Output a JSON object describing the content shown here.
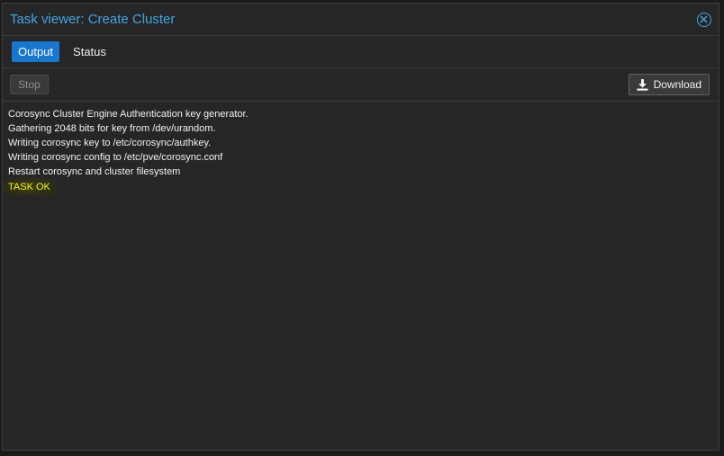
{
  "window": {
    "title": "Task viewer: Create Cluster"
  },
  "tabs": [
    {
      "label": "Output",
      "active": true
    },
    {
      "label": "Status",
      "active": false
    }
  ],
  "toolbar": {
    "stop_label": "Stop",
    "download_label": "Download"
  },
  "log": {
    "lines": [
      "Corosync Cluster Engine Authentication key generator.",
      "Gathering 2048 bits for key from /dev/urandom.",
      "Writing corosync key to /etc/corosync/authkey.",
      "Writing corosync config to /etc/pve/corosync.conf",
      "Restart corosync and cluster filesystem"
    ],
    "status_line": "TASK OK"
  },
  "colors": {
    "accent": "#3fa6e8",
    "tab_active": "#1776d0",
    "status_ok": "#f4f400"
  },
  "icons": {
    "close": "close-circle-icon",
    "download": "download-icon"
  }
}
